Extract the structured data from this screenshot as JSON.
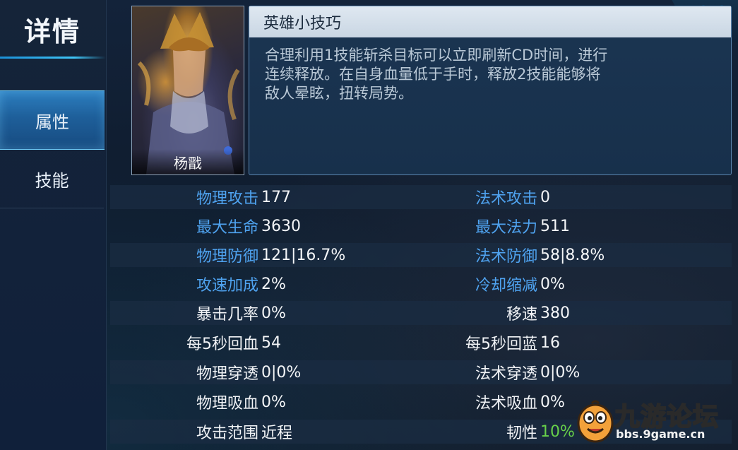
{
  "sidebar": {
    "title": "详情",
    "tabs": [
      {
        "label": "属性",
        "active": true
      },
      {
        "label": "技能",
        "active": false
      }
    ]
  },
  "hero": {
    "name": "杨戬"
  },
  "tip": {
    "title": "英雄小技巧",
    "body_lines": [
      "合理利用1技能斩杀目标可以立即刷新CD时间，进行",
      "连续释放。在自身血量低于手时，释放2技能能够将",
      "敌人晕眩，扭转局势。"
    ]
  },
  "stats": {
    "left": [
      {
        "label": "物理攻击",
        "value": "177",
        "label_color": "blue"
      },
      {
        "label": "最大生命",
        "value": "3630",
        "label_color": "blue"
      },
      {
        "label": "物理防御",
        "value": "121|16.7%",
        "label_color": "blue"
      },
      {
        "label": "攻速加成",
        "value": "2%",
        "label_color": "blue"
      },
      {
        "label": "暴击几率",
        "value": "0%",
        "label_color": "white"
      },
      {
        "label": "每5秒回血",
        "value": "54",
        "label_color": "white"
      },
      {
        "label": "物理穿透",
        "value": "0|0%",
        "label_color": "white"
      },
      {
        "label": "物理吸血",
        "value": "0%",
        "label_color": "white"
      },
      {
        "label": "攻击范围",
        "value": "近程",
        "label_color": "white"
      }
    ],
    "right": [
      {
        "label": "法术攻击",
        "value": "0",
        "label_color": "blue"
      },
      {
        "label": "最大法力",
        "value": "511",
        "label_color": "blue"
      },
      {
        "label": "法术防御",
        "value": "58|8.8%",
        "label_color": "blue"
      },
      {
        "label": "冷却缩减",
        "value": "0%",
        "label_color": "blue"
      },
      {
        "label": "移速",
        "value": "380",
        "label_color": "white"
      },
      {
        "label": "每5秒回蓝",
        "value": "16",
        "label_color": "white"
      },
      {
        "label": "法术穿透",
        "value": "0|0%",
        "label_color": "white"
      },
      {
        "label": "法术吸血",
        "value": "0%",
        "label_color": "white"
      },
      {
        "label": "韧性",
        "value": "10%",
        "label_color": "white",
        "value_color": "green"
      }
    ]
  },
  "watermark": {
    "brand": "九游论坛",
    "url": "bbs.9game.cn"
  },
  "colors": {
    "accent_blue": "#4fa3f0",
    "positive_green": "#67d04a",
    "active_tab": "#1e5f9a"
  },
  "icons": {
    "close": "close-x-icon"
  }
}
